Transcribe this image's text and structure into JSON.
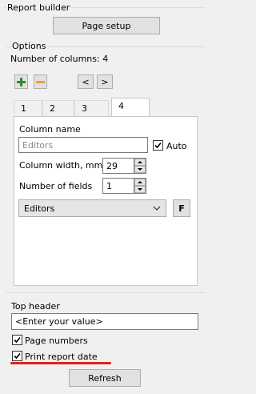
{
  "report_builder": {
    "title": "Report builder",
    "page_setup_label": "Page setup"
  },
  "options": {
    "title": "Options",
    "columns_count_label": "Number of columns: 4",
    "add_icon": "green-plus-icon",
    "remove_icon": "orange-minus-icon",
    "prev_label": "<",
    "next_label": ">",
    "tabs": [
      "1",
      "2",
      "3",
      "4"
    ],
    "active_tab": "4",
    "column_name_label": "Column name",
    "column_name_placeholder": "Editors",
    "auto_label": "Auto",
    "auto_checked": true,
    "column_width_label": "Column width, mm",
    "column_width_value": "29",
    "number_of_fields_label": "Number of fields",
    "number_of_fields_value": "1",
    "field_select_value": "Editors",
    "format_button_label": "F"
  },
  "top_header": {
    "label": "Top header",
    "value": "<Enter your value>"
  },
  "page_numbers": {
    "label": "Page numbers",
    "checked": true
  },
  "print_report_date": {
    "label": "Print report date",
    "checked": true,
    "underline_color": "#e02020"
  },
  "refresh_label": "Refresh",
  "colors": {
    "accent_green": "#2e8b2e",
    "accent_orange": "#e6a23c",
    "underline_red": "#e02020"
  }
}
